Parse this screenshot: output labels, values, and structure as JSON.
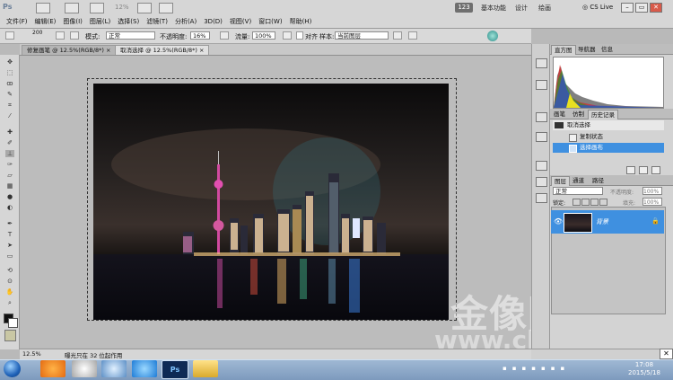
{
  "app": {
    "icon_text": "Ps",
    "zoom_top": "12%",
    "badge": "123"
  },
  "menu": [
    "文件(F)",
    "编辑(E)",
    "图像(I)",
    "图层(L)",
    "选择(S)",
    "滤镜(T)",
    "分析(A)",
    "3D(D)",
    "视图(V)",
    "窗口(W)",
    "帮助(H)"
  ],
  "workspaces": [
    "基本功能",
    "设计",
    "绘画"
  ],
  "cs_live": "CS Live",
  "options": {
    "brush_size": "200",
    "mode_label": "模式:",
    "mode_value": "正常",
    "opacity_label": "不透明度:",
    "opacity_value": "16%",
    "flow_label": "流量:",
    "flow_value": "100%",
    "align_label": "对齐",
    "sample_label": "样本:",
    "sample_value": "当前图层"
  },
  "tabs": [
    {
      "label": "修复画笔 @ 12.5%(RGB/8*) ×"
    },
    {
      "label": "取消选择 @ 12.5%(RGB/8*) ×"
    }
  ],
  "status": {
    "zoom": "12.5%",
    "message": "曝光只在 32 位起作用"
  },
  "panels": {
    "top_tabs": [
      "直方图",
      "导航器",
      "信息"
    ],
    "mid_tabs": [
      "画笔",
      "仿制",
      "历史记录"
    ],
    "history_snapshot": "取消选择",
    "history_items": [
      "复制状态",
      "选择画布"
    ],
    "layers_tabs": [
      "图层",
      "通道",
      "路径"
    ],
    "blend_mode": "正常",
    "opacity_label": "不透明度:",
    "opacity_value": "100%",
    "lock_label": "锁定:",
    "fill_label": "填充:",
    "fill_value": "100%",
    "layer_name": "背景"
  },
  "watermark": {
    "line1": "金像图片网",
    "line2": "www.chinajxtp.com"
  },
  "taskbar": {
    "time": "17:08",
    "date": "2015/5/18"
  },
  "colors": {
    "accent": "#3f90e0",
    "chrome": "#d6d6d6"
  }
}
